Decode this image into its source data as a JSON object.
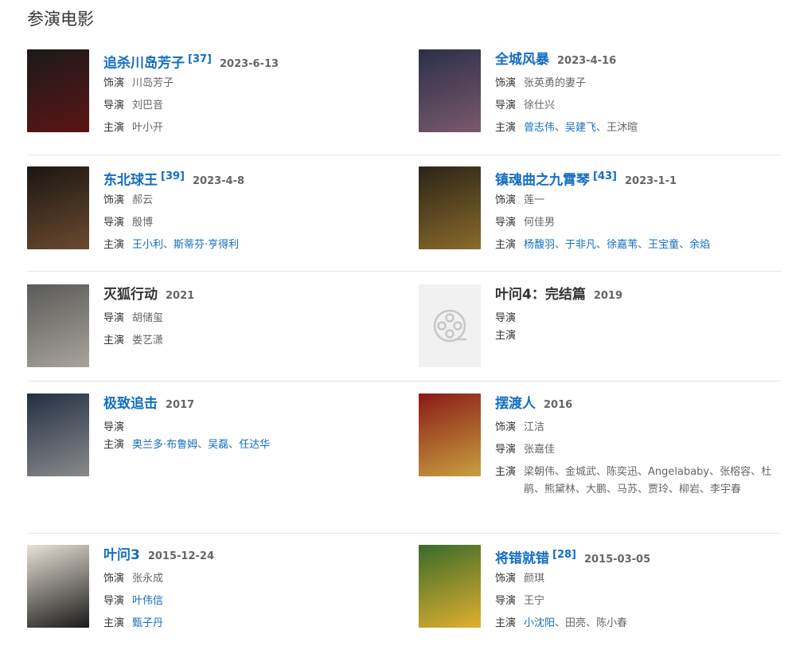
{
  "section_title": "参演电影",
  "films": [
    {
      "title": "追杀川岛芳子",
      "ref": "[37]",
      "date": "2023-6-13",
      "linked": true,
      "role_label": "饰演",
      "role": "川岛芳子",
      "director_label": "导演",
      "director": "刘巴音",
      "director_link": false,
      "cast_label": "主演",
      "cast": [
        {
          "name": "叶小开",
          "link": false
        }
      ],
      "poster_colors": [
        "#1c1a1a",
        "#5b1414"
      ]
    },
    {
      "title": "全城风暴",
      "ref": "",
      "date": "2023-4-16",
      "linked": true,
      "role_label": "饰演",
      "role": "张英勇的妻子",
      "director_label": "导演",
      "director": "徐仕兴",
      "director_link": false,
      "cast_label": "主演",
      "cast": [
        {
          "name": "曾志伟",
          "link": true
        },
        {
          "name": "吴建飞",
          "link": true
        },
        {
          "name": "王沐暄",
          "link": false
        }
      ],
      "poster_colors": [
        "#2b2f4a",
        "#7a5a6a"
      ]
    },
    {
      "title": "东北球王",
      "ref": "[39]",
      "date": "2023-4-8",
      "linked": true,
      "role_label": "饰演",
      "role": "郝云",
      "director_label": "导演",
      "director": "殷博",
      "director_link": false,
      "cast_label": "主演",
      "cast": [
        {
          "name": "王小利",
          "link": true
        },
        {
          "name": "斯蒂芬·亨得利",
          "link": true
        }
      ],
      "poster_colors": [
        "#1a1612",
        "#6b4a30"
      ]
    },
    {
      "title": "镇魂曲之九霄琴",
      "ref": "[43]",
      "date": "2023-1-1",
      "linked": true,
      "role_label": "饰演",
      "role": "莲一",
      "director_label": "导演",
      "director": "何佳男",
      "director_link": false,
      "cast_label": "主演",
      "cast": [
        {
          "name": "杨馥羽",
          "link": true
        },
        {
          "name": "于非凡",
          "link": true
        },
        {
          "name": "徐嘉苇",
          "link": true
        },
        {
          "name": "王宝童",
          "link": true
        },
        {
          "name": "余焰",
          "link": true
        }
      ],
      "poster_colors": [
        "#2a2418",
        "#8a6a2a"
      ]
    },
    {
      "title": "灭狐行动",
      "ref": "",
      "date": "2021",
      "linked": false,
      "role_label": "",
      "role": "",
      "director_label": "导演",
      "director": "胡储玺",
      "director_link": false,
      "cast_label": "主演",
      "cast": [
        {
          "name": "娄艺潇",
          "link": false
        }
      ],
      "poster_colors": [
        "#5a5a58",
        "#a8a49c"
      ]
    },
    {
      "title": "叶问4：完结篇",
      "ref": "",
      "date": "2019",
      "linked": false,
      "role_label": "",
      "role": "",
      "director_label": "导演",
      "director": "",
      "director_link": false,
      "cast_label": "主演",
      "cast": [],
      "poster_colors": []
    },
    {
      "title": "极致追击",
      "ref": "",
      "date": "2017",
      "linked": true,
      "role_label": "",
      "role": "",
      "director_label": "导演",
      "director": "",
      "director_link": false,
      "cast_label": "主演",
      "cast": [
        {
          "name": "奥兰多·布鲁姆",
          "link": true
        },
        {
          "name": "吴磊",
          "link": true
        },
        {
          "name": "任达华",
          "link": true
        }
      ],
      "poster_colors": [
        "#223044",
        "#8a8a8a"
      ]
    },
    {
      "title": "摆渡人",
      "ref": "",
      "date": "2016",
      "linked": true,
      "role_label": "饰演",
      "role": "江洁",
      "director_label": "导演",
      "director": "张嘉佳",
      "director_link": false,
      "cast_label": "主演",
      "cast_text": "梁朝伟、金城武、陈奕迅、Angelababy、张榕容、杜鹃、熊黛林、大鹏、马苏、贾玲、柳岩、李宇春",
      "cast": [],
      "poster_colors": [
        "#8a1a16",
        "#c8a040"
      ]
    },
    {
      "title": "叶问3",
      "ref": "",
      "date": "2015-12-24",
      "linked": true,
      "role_label": "饰演",
      "role": "张永成",
      "director_label": "导演",
      "director": "叶伟信",
      "director_link": true,
      "cast_label": "主演",
      "cast": [
        {
          "name": "甄子丹",
          "link": true
        }
      ],
      "poster_colors": [
        "#e8e2d6",
        "#1a1a1a"
      ]
    },
    {
      "title": "将错就错",
      "ref": "[28]",
      "date": "2015-03-05",
      "linked": true,
      "role_label": "饰演",
      "role": "颜琪",
      "director_label": "导演",
      "director": "王宁",
      "director_link": false,
      "cast_label": "主演",
      "cast": [
        {
          "name": "小沈阳",
          "link": true
        },
        {
          "name": "田亮",
          "link": false
        },
        {
          "name": "陈小春",
          "link": false
        }
      ],
      "poster_colors": [
        "#3a6a2a",
        "#e0b030"
      ]
    }
  ]
}
